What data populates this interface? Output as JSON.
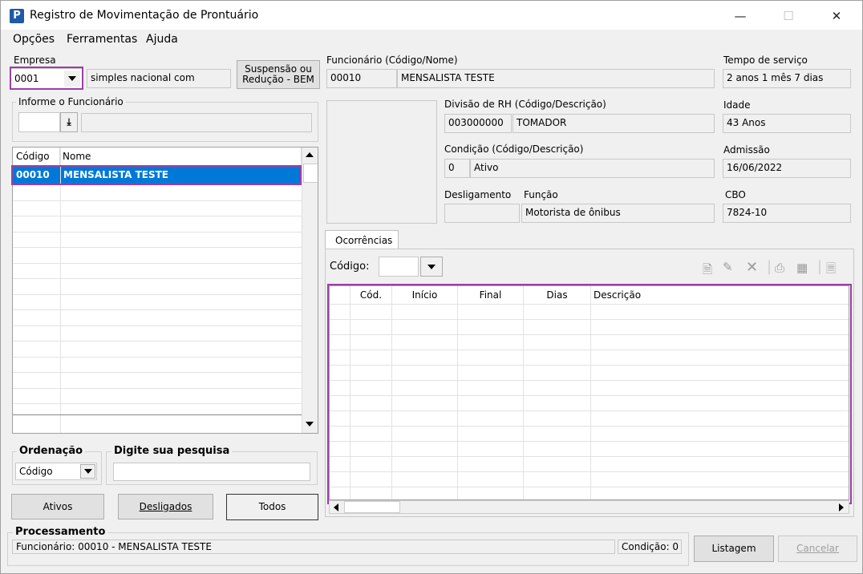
{
  "window": {
    "title": "Registro de Movimentação de Prontuário",
    "logo": "P"
  },
  "menu": [
    "Opções",
    "Ferramentas",
    "Ajuda"
  ],
  "empresa": {
    "label": "Empresa",
    "code": "0001",
    "name": "simples nacional com"
  },
  "suspensao_button": [
    "Suspensão ou",
    "Redução - BEM"
  ],
  "funcionario": {
    "label": "Funcionário (Código/Nome)",
    "code": "00010",
    "name": "MENSALISTA TESTE"
  },
  "tempo_servico": {
    "label": "Tempo de serviço",
    "value": "2 anos 1 mês 7 dias"
  },
  "informe": {
    "label": "Informe o Funcionário"
  },
  "divisao": {
    "label": "Divisão de RH (Código/Descrição)",
    "code": "003000000",
    "desc": "TOMADOR"
  },
  "idade": {
    "label": "Idade",
    "value": "43 Anos"
  },
  "condicao": {
    "label": "Condição (Código/Descrição)",
    "code": "0",
    "desc": "Ativo"
  },
  "admissao": {
    "label": "Admissão",
    "value": "16/06/2022"
  },
  "desligamento": {
    "label": "Desligamento",
    "value": ""
  },
  "funcao": {
    "label": "Função",
    "value": "Motorista de ônibus"
  },
  "cbo": {
    "label": "CBO",
    "value": "7824-10"
  },
  "employee_list": {
    "columns": [
      "Código",
      "Nome"
    ],
    "rows": [
      {
        "codigo": "00010",
        "nome": "MENSALISTA TESTE"
      }
    ]
  },
  "ordenacao": {
    "label": "Ordenação",
    "value": "Código"
  },
  "pesquisa": {
    "label": "Digite sua pesquisa",
    "value": ""
  },
  "filter_buttons": {
    "ativos": "Ativos",
    "desligados": "Desligados",
    "todos": "Todos"
  },
  "ocorrencias": {
    "tab": "Ocorrências",
    "codigo_label": "Código:",
    "codigo_value": "",
    "columns": [
      "Cód.",
      "Início",
      "Final",
      "Dias",
      "Descrição"
    ],
    "toolbar_icons": [
      "new-document-icon",
      "edit-pencil-icon",
      "delete-x-icon",
      "print-icon",
      "export-icon",
      "report-icon"
    ]
  },
  "processamento": {
    "label": "Processamento",
    "status": "Funcionário: 00010 - MENSALISTA TESTE",
    "condicao": "Condição: 0"
  },
  "footer_buttons": {
    "listagem": "Listagem",
    "cancelar": "Cancelar"
  },
  "colors": {
    "accent_highlight": "#9b3fa8",
    "selection": "#0078d7",
    "logo": "#1e5aa8"
  }
}
